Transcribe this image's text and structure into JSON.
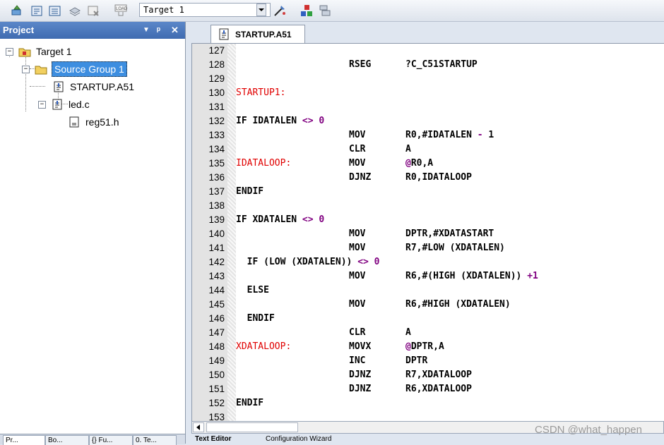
{
  "toolbar": {
    "target_value": "Target 1"
  },
  "project": {
    "title": "Project",
    "pin_label": "▼ ᵖ ✕",
    "tree": [
      {
        "label": "Target 1"
      },
      {
        "label": "Source Group 1"
      },
      {
        "label": "STARTUP.A51"
      },
      {
        "label": "led.c"
      },
      {
        "label": "reg51.h"
      }
    ],
    "bottom_tabs": [
      "Pr...",
      "Bo...",
      "{} Fu...",
      "0. Te..."
    ]
  },
  "editor": {
    "file_tab": "STARTUP.A51",
    "lines": [
      {
        "n": "127",
        "a": "",
        "b": "",
        "c": ""
      },
      {
        "n": "128",
        "a": "",
        "b": "RSEG",
        "c": "?C_C51STARTUP"
      },
      {
        "n": "129",
        "a": "",
        "b": "",
        "c": ""
      },
      {
        "n": "130",
        "a": "STARTUP1:",
        "b": "",
        "c": ""
      },
      {
        "n": "131",
        "a": "",
        "b": "",
        "c": ""
      },
      {
        "n": "132",
        "a": "IF IDATALEN <> 0",
        "b": "",
        "c": ""
      },
      {
        "n": "133",
        "a": "",
        "b": "MOV",
        "c": "R0,#IDATALEN - 1"
      },
      {
        "n": "134",
        "a": "",
        "b": "CLR",
        "c": "A"
      },
      {
        "n": "135",
        "a": "IDATALOOP:",
        "b": "MOV",
        "c": "@R0,A"
      },
      {
        "n": "136",
        "a": "",
        "b": "DJNZ",
        "c": "R0,IDATALOOP"
      },
      {
        "n": "137",
        "a": "ENDIF",
        "b": "",
        "c": ""
      },
      {
        "n": "138",
        "a": "",
        "b": "",
        "c": ""
      },
      {
        "n": "139",
        "a": "IF XDATALEN <> 0",
        "b": "",
        "c": ""
      },
      {
        "n": "140",
        "a": "",
        "b": "MOV",
        "c": "DPTR,#XDATASTART"
      },
      {
        "n": "141",
        "a": "",
        "b": "MOV",
        "c": "R7,#LOW (XDATALEN)"
      },
      {
        "n": "142",
        "a": "  IF (LOW (XDATALEN)) <> 0",
        "b": "",
        "c": ""
      },
      {
        "n": "143",
        "a": "",
        "b": "MOV",
        "c": "R6,#(HIGH (XDATALEN)) +1"
      },
      {
        "n": "144",
        "a": "  ELSE",
        "b": "",
        "c": ""
      },
      {
        "n": "145",
        "a": "",
        "b": "MOV",
        "c": "R6,#HIGH (XDATALEN)"
      },
      {
        "n": "146",
        "a": "  ENDIF",
        "b": "",
        "c": ""
      },
      {
        "n": "147",
        "a": "",
        "b": "CLR",
        "c": "A"
      },
      {
        "n": "148",
        "a": "XDATALOOP:",
        "b": "MOVX",
        "c": "@DPTR,A"
      },
      {
        "n": "149",
        "a": "",
        "b": "INC",
        "c": "DPTR"
      },
      {
        "n": "150",
        "a": "",
        "b": "DJNZ",
        "c": "R7,XDATALOOP"
      },
      {
        "n": "151",
        "a": "",
        "b": "DJNZ",
        "c": "R6,XDATALOOP"
      },
      {
        "n": "152",
        "a": "ENDIF",
        "b": "",
        "c": ""
      },
      {
        "n": "153",
        "a": "",
        "b": "",
        "c": ""
      }
    ],
    "bottom_tabs": [
      "Text Editor",
      "Configuration Wizard"
    ]
  },
  "watermark": "CSDN @what_happen",
  "colors": {
    "label": "#e00000",
    "number": "#800080",
    "selection": "#3d8ee0",
    "header": "#3f6bb0"
  }
}
